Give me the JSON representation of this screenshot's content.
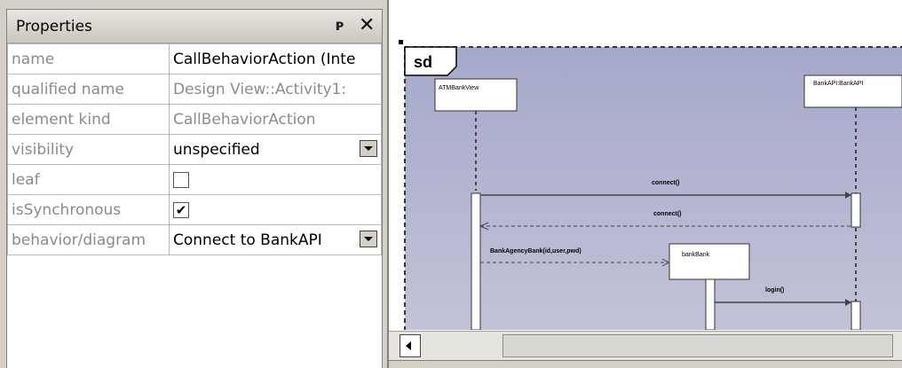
{
  "properties_panel": {
    "title": "Properties",
    "pin_glyph": "p",
    "close_glyph": "✕",
    "rows": [
      {
        "key": "name",
        "value": "CallBehaviorAction (Inte"
      },
      {
        "key": "qualified name",
        "value": "Design View::Activity1:"
      },
      {
        "key": "element kind",
        "value": "CallBehaviorAction"
      },
      {
        "key": "visibility",
        "value": "unspecified"
      },
      {
        "key": "leaf",
        "value": ""
      },
      {
        "key": "isSynchronous",
        "value": "✔"
      },
      {
        "key": "behavior/diagram",
        "value": "Connect to BankAPI"
      }
    ]
  },
  "diagram": {
    "frame_label": "sd",
    "lifelines": [
      "ATMBankView",
      "BankAPI:BankAPI",
      "bankBank"
    ],
    "messages": [
      "connect()",
      "connect()",
      "BankAgencyBank(id,user,pwd)",
      "login()"
    ]
  },
  "colors": {
    "frame_bg": "#aeb0cf",
    "panel_bg": "#d4d0c8"
  }
}
